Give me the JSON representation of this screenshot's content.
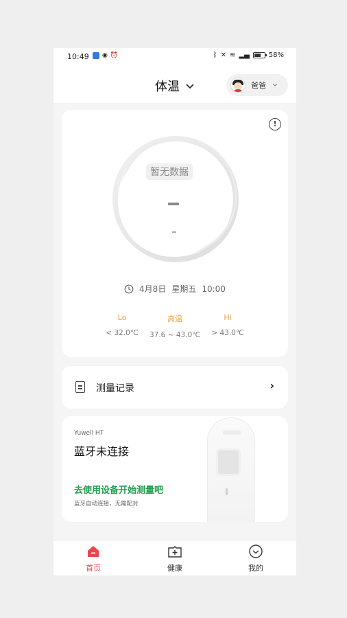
{
  "status_bar": {
    "time": "10:49",
    "battery": "58%",
    "battery_level": 0.58
  },
  "header": {
    "title": "体温",
    "user_name": "爸爸"
  },
  "main_card": {
    "no_data": "暂无数据",
    "reading": "--",
    "date": "4月8日",
    "weekday": "星期五",
    "time": "10:00",
    "ranges": [
      {
        "label": "Lo",
        "value": "< 32.0℃"
      },
      {
        "label": "高温",
        "value": "37.6 ~ 43.0℃"
      },
      {
        "label": "Hi",
        "value": "> 43.0℃"
      }
    ]
  },
  "records": {
    "label": "测量记录"
  },
  "device": {
    "model": "Yuwell HT",
    "status": "蓝牙未连接",
    "cta": "去使用设备开始测量吧",
    "hint": "蓝牙自动连接，无需配对"
  },
  "tabs": [
    {
      "label": "首页",
      "icon": "home-icon",
      "active": true
    },
    {
      "label": "健康",
      "icon": "health-icon",
      "active": false
    },
    {
      "label": "我的",
      "icon": "profile-icon",
      "active": false
    }
  ],
  "colors": {
    "accent": "#e8474d",
    "cta_green": "#22a04e",
    "range_label": "#e6a24c"
  }
}
